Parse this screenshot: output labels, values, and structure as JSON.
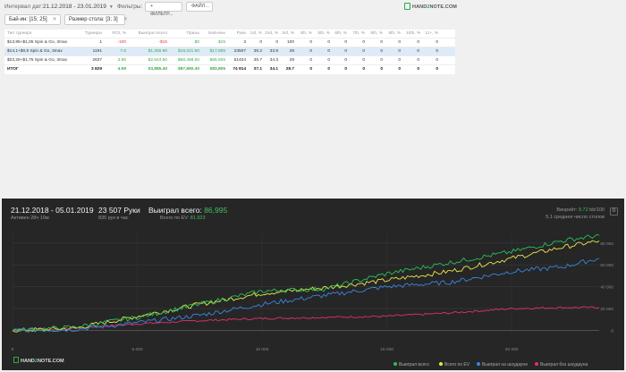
{
  "toolbar": {
    "date_label": "Интервал дат:",
    "date_range": "21.12.2018 - 23.01.2019",
    "filters_label": "Фильтры:",
    "filter_button": "ФИЛЬТР...",
    "file_button": "ФАЙЛ...",
    "logo_text_a": "HAND",
    "logo_text_b": "2",
    "logo_text_c": "NOTE.COM"
  },
  "chips": [
    {
      "label": "Бай-ин: [15; 25]"
    },
    {
      "label": "Размер стола: [3; 3]"
    }
  ],
  "table": {
    "columns": [
      "Тип турнира",
      "Турниры",
      "ROI, %",
      "Выиграл всего",
      "Призы",
      "Бай-ины",
      "Руки",
      "1st, %",
      "2nd, %",
      "3rd, %",
      "4th, %",
      "5th, %",
      "6th, %",
      "7th, %",
      "8th, %",
      "9th, %",
      "10th, %",
      "11+, %"
    ],
    "rows": [
      [
        "$13,95+$1,05 Spin & Go, 3max",
        "1",
        "-100",
        "-$15",
        "$0",
        "$15",
        "3",
        "0",
        "0",
        "100",
        "0",
        "0",
        "0",
        "0",
        "0",
        "0",
        "0",
        "0"
      ],
      [
        "$14,1+$0,9 Spin & Go, 3max",
        "1191",
        "7.6",
        "$1,356.90",
        "$19,221.90",
        "$17,865",
        "23507",
        "38.2",
        "33.8",
        "28",
        "0",
        "0",
        "0",
        "0",
        "0",
        "0",
        "0",
        "0"
      ],
      [
        "$23,25+$1,75 Spin & Go, 3max",
        "2637",
        "3.86",
        "$2,543.50",
        "$68,468.50",
        "$65,925",
        "51404",
        "36.7",
        "34.3",
        "29",
        "0",
        "0",
        "0",
        "0",
        "0",
        "0",
        "0",
        "0"
      ]
    ],
    "total": [
      "ИТОГ",
      "3 829",
      "4.99",
      "$3,885.40",
      "$87,690.40",
      "$83,805",
      "74 914",
      "37.1",
      "34.1",
      "28.7",
      "0",
      "0",
      "0",
      "0",
      "0",
      "0",
      "0",
      "0"
    ]
  },
  "panel": {
    "date_range": "21.12.2018 - 05.01.2019",
    "active": "Активен 28ч 10м",
    "hands": "23 507 Руки",
    "hands_per_hour": "835 рук в час",
    "won_label": "Выиграл всего:",
    "won_value": "86,995",
    "ev_label": "Всего по EV:",
    "ev_value": "81,923",
    "winrate_label": "Винрейт:",
    "winrate_value": "9.72",
    "winrate_unit": "bb/100",
    "tables_avg": "5.1 среднее число столов",
    "settings_icon": "gear-icon"
  },
  "legend": [
    {
      "label": "Выиграл всего",
      "color": "#29c05a"
    },
    {
      "label": "Всего по EV",
      "color": "#e8e84a"
    },
    {
      "label": "Выиграл на шоудауне",
      "color": "#3a86e0"
    },
    {
      "label": "Выиграл без шоудауна",
      "color": "#e0326a"
    }
  ],
  "chart_data": {
    "type": "line",
    "x_ticks": [
      "0",
      "5 000",
      "10 000",
      "15 000",
      "20 000"
    ],
    "y_ticks": [
      "0",
      "20 000",
      "40 000",
      "60 000",
      "80 000"
    ],
    "xlim": [
      0,
      23507
    ],
    "ylim": [
      -2000,
      88000
    ],
    "series": [
      {
        "name": "Выиграл всего",
        "color": "#29c05a",
        "x": [
          0,
          2500,
          5000,
          7500,
          10000,
          12500,
          15000,
          17500,
          20000,
          22000,
          23507
        ],
        "y": [
          0,
          3000,
          12000,
          24000,
          36000,
          38000,
          52000,
          62000,
          72000,
          82000,
          86995
        ]
      },
      {
        "name": "Всего по EV",
        "color": "#e8e84a",
        "x": [
          0,
          2500,
          5000,
          7500,
          10000,
          12500,
          15000,
          17500,
          20000,
          22000,
          23507
        ],
        "y": [
          0,
          2000,
          13000,
          24000,
          34000,
          39000,
          46000,
          54000,
          66000,
          76000,
          81923
        ]
      },
      {
        "name": "Выиграл на шоудауне",
        "color": "#3a86e0",
        "x": [
          0,
          2500,
          5000,
          7500,
          10000,
          12500,
          15000,
          17500,
          20000,
          22000,
          23507
        ],
        "y": [
          0,
          1000,
          7000,
          14000,
          24000,
          32000,
          40000,
          44000,
          54000,
          58000,
          66000
        ]
      },
      {
        "name": "Выиграл без шоудауна",
        "color": "#e0326a",
        "x": [
          0,
          2500,
          5000,
          7500,
          10000,
          12500,
          15000,
          17500,
          20000,
          22000,
          23507
        ],
        "y": [
          0,
          2000,
          6000,
          9000,
          11000,
          12000,
          13000,
          16000,
          20000,
          21000,
          21000
        ]
      }
    ],
    "grid": true
  },
  "watermark": {
    "a": "HAND",
    "b": "2",
    "c": "NOTE.COM"
  }
}
